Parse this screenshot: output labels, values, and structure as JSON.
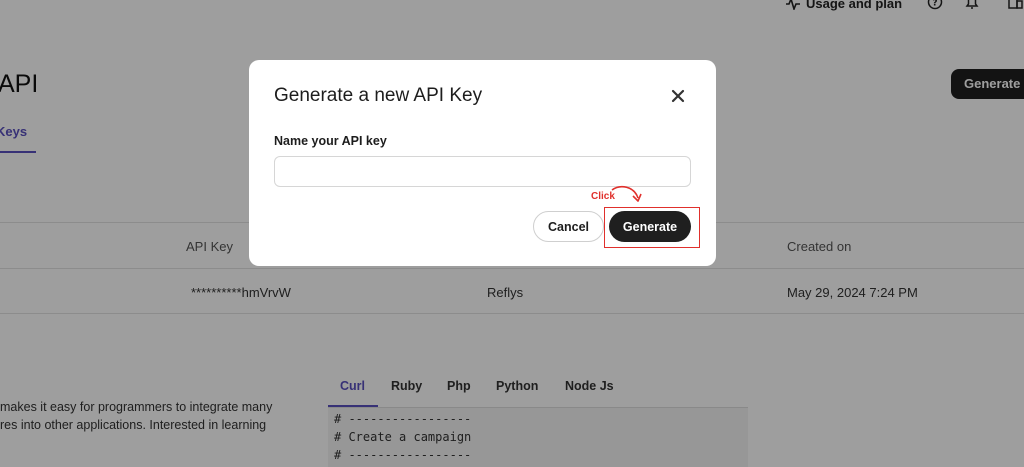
{
  "nav": {
    "usage_label": "Usage and plan"
  },
  "page": {
    "title": "API",
    "generate_button": "Generate",
    "tab_label": "Keys"
  },
  "table": {
    "headers": [
      "API Key",
      "Created on"
    ],
    "row": {
      "key": "**********hmVrvW",
      "name": "Reflys",
      "created": "May 29, 2024 7:24 PM"
    }
  },
  "description": {
    "line1": "makes it easy for programmers to integrate many",
    "line2": "res into other applications. Interested in learning"
  },
  "code": {
    "tabs": [
      "Curl",
      "Ruby",
      "Php",
      "Python",
      "Node Js"
    ],
    "active_tab": "Curl",
    "lines": [
      "# -----------------",
      "# Create a campaign",
      "# -----------------"
    ]
  },
  "modal": {
    "title": "Generate a new API Key",
    "field_label": "Name your API key",
    "input_value": "",
    "cancel_label": "Cancel",
    "generate_label": "Generate",
    "annotation": "Click",
    "annotation_color": "#e0302c"
  }
}
